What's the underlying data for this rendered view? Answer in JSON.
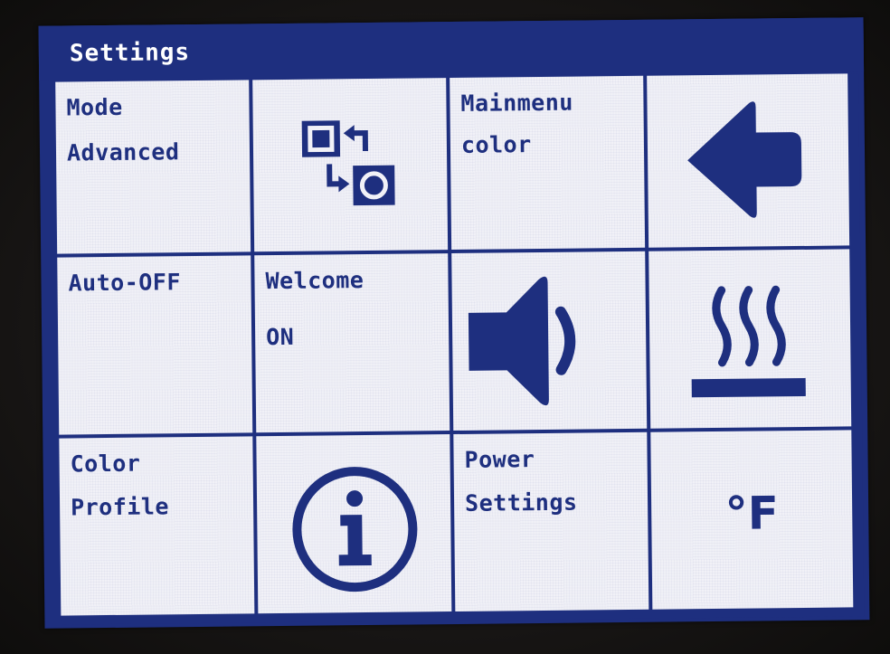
{
  "header": {
    "title": "Settings"
  },
  "tiles": {
    "mode": {
      "label": "Mode",
      "value": "Advanced"
    },
    "mainmenu_color": {
      "line1": "Mainmenu",
      "line2": "color"
    },
    "auto_off": {
      "label": "Auto-OFF"
    },
    "welcome": {
      "label": "Welcome",
      "value": "ON"
    },
    "color_profile": {
      "line1": "Color",
      "line2": "Profile"
    },
    "power_settings": {
      "line1": "Power",
      "line2": "Settings"
    },
    "unit": {
      "value": "°F"
    }
  },
  "icons": {
    "swap": "swap-shapes-icon",
    "back": "back-arrow-icon",
    "sound": "speaker-icon",
    "heat": "heat-plate-icon",
    "info": "info-icon"
  },
  "colors": {
    "accent": "#1e2f7f",
    "tile_background": "#f1f1f7",
    "title_text": "#ffffff"
  }
}
